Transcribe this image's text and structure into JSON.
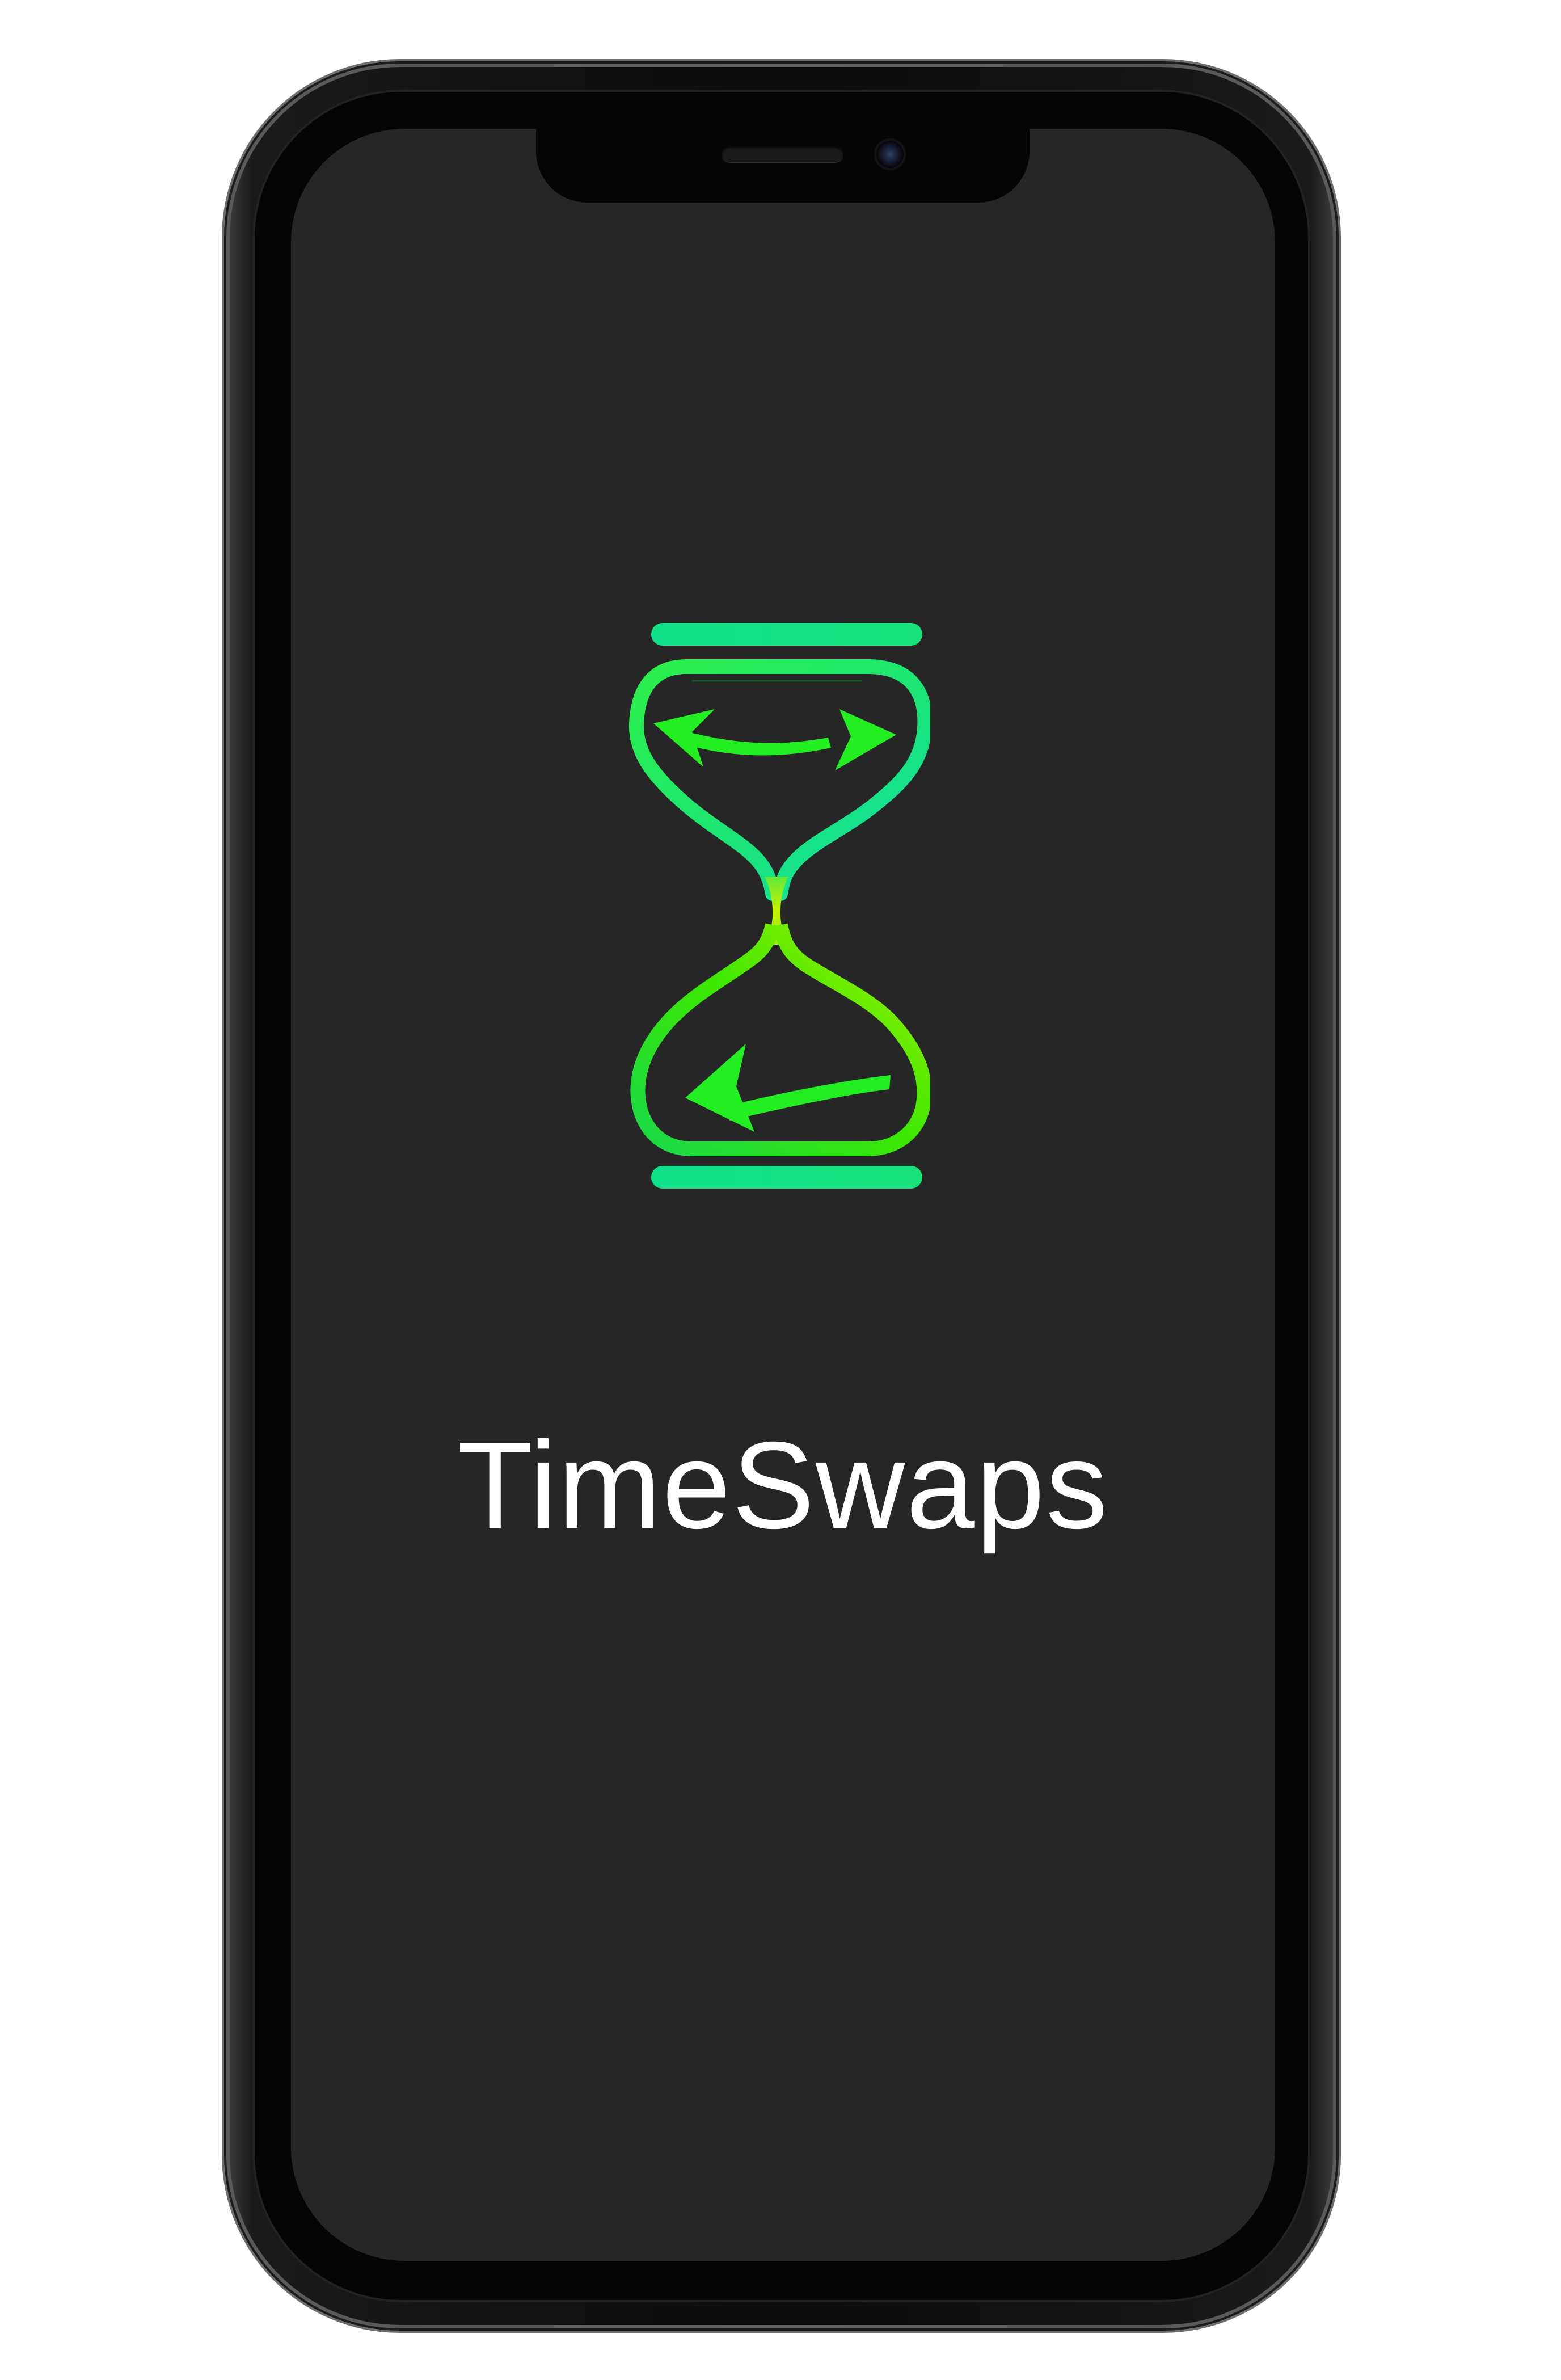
{
  "device": {
    "type": "smartphone",
    "frame_color": "#0b0b0b",
    "screen_color": "#262626"
  },
  "splash": {
    "logo_icon": "hourglass-swap-arrows-icon",
    "logo_colors": {
      "bar": "#12e07e",
      "glass_top": "#1ee66a",
      "glass_neck": "#b6f000",
      "glass_bottom": "#2ae000",
      "arrows": "#22ee22"
    },
    "app_name": "TimeSwaps"
  }
}
